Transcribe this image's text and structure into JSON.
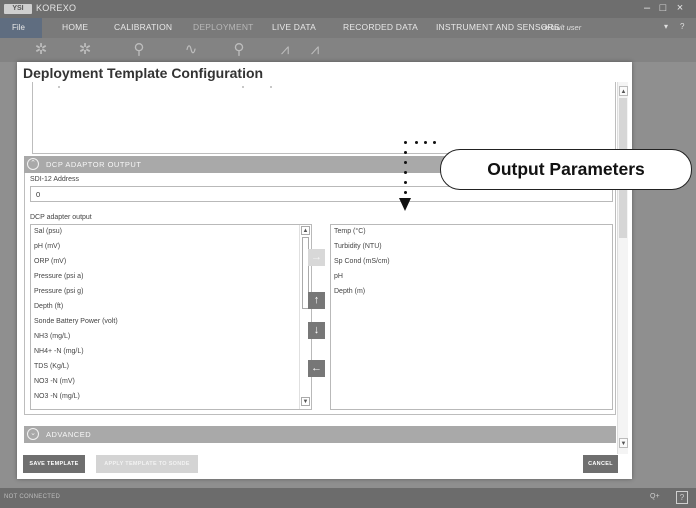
{
  "app": {
    "logo_text": "YSI",
    "title": "KOREXO",
    "window_controls": [
      "–",
      "□",
      "×"
    ]
  },
  "menu": {
    "file": "File",
    "tabs": [
      {
        "label": "HOME"
      },
      {
        "label": "CALIBRATION"
      },
      {
        "label": "DEPLOYMENT"
      },
      {
        "label": "LIVE DATA"
      },
      {
        "label": "RECORDED DATA"
      },
      {
        "label": "INSTRUMENT AND SENSORS"
      }
    ],
    "user": "default user",
    "user_caret": "▾",
    "help": "?"
  },
  "toolbar": {
    "icons": [
      "settings-icon",
      "settings-alt-icon",
      "search-icon",
      "probe-icon",
      "zoom-icon",
      "graph-icon",
      "graph-alt-icon"
    ]
  },
  "dialog": {
    "title": "Deployment Template Configuration",
    "section_dcp": {
      "icon": "⌃",
      "title": "DCP ADAPTOR OUTPUT",
      "sdi_label": "SDI-12 Address",
      "sdi_value": "0",
      "output_label": "DCP adapter output",
      "available": [
        "Sal (psu)",
        "pH (mV)",
        "ORP (mV)",
        "Pressure (psi a)",
        "Pressure (psi g)",
        "Depth (ft)",
        "Sonde Battery Power (volt)",
        "NH3 (mg/L)",
        "NH4+ -N (mg/L)",
        "TDS (Kg/L)",
        "NO3 -N (mV)",
        "NO3 -N (mg/L)"
      ],
      "selected": [
        "Temp (°C)",
        "Turbidity (NTU)",
        "Sp Cond (mS/cm)",
        "pH",
        "Depth (m)"
      ],
      "buttons": {
        "add": "→",
        "up": "↑",
        "down": "↓",
        "remove": "←"
      }
    },
    "section_advanced": {
      "icon": "⌄",
      "title": "ADVANCED"
    },
    "footer": {
      "save": "SAVE TEMPLATE",
      "apply": "APPLY TEMPLATE TO SONDE",
      "cancel": "CANCEL"
    }
  },
  "statusbar": {
    "text": "NOT CONNECTED",
    "right": "Q+",
    "help": "?"
  },
  "callout": {
    "text": "Output Parameters"
  }
}
